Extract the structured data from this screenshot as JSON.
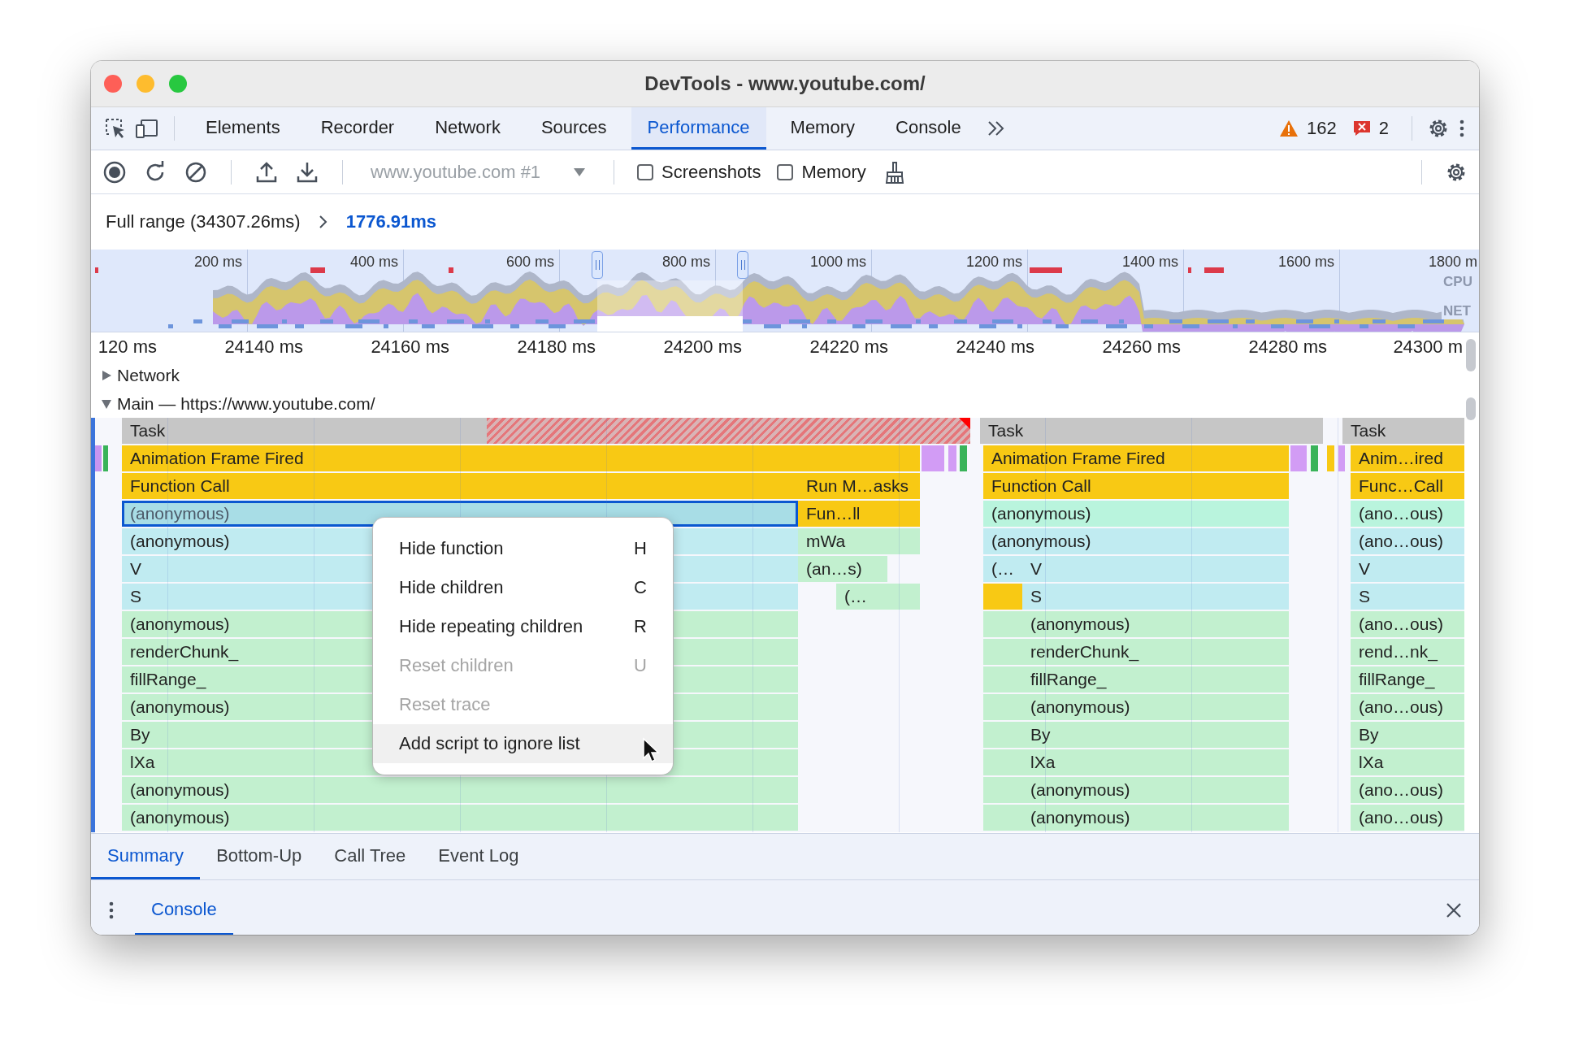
{
  "window": {
    "title": "DevTools - www.youtube.com/"
  },
  "tabs": [
    {
      "label": "Elements",
      "selected": false
    },
    {
      "label": "Recorder",
      "selected": false
    },
    {
      "label": "Network",
      "selected": false
    },
    {
      "label": "Sources",
      "selected": false
    },
    {
      "label": "Performance",
      "selected": true
    },
    {
      "label": "Memory",
      "selected": false
    },
    {
      "label": "Console",
      "selected": false
    }
  ],
  "issues": {
    "warnings": "162",
    "errors": "2"
  },
  "toolbar": {
    "target": "www.youtube.com #1",
    "checkboxes": [
      {
        "label": "Screenshots",
        "checked": false
      },
      {
        "label": "Memory",
        "checked": false
      }
    ]
  },
  "breadcrumb": {
    "full_range": "Full range (34307.26ms)",
    "current": "1776.91ms"
  },
  "overview": {
    "ticks": [
      "200 ms",
      "400 ms",
      "600 ms",
      "800 ms",
      "1000 ms",
      "1200 ms",
      "1400 ms",
      "1600 ms",
      "1800 m"
    ],
    "cpu_label": "CPU",
    "net_label": "NET"
  },
  "ruler": [
    "120 ms",
    "24140 ms",
    "24160 ms",
    "24180 ms",
    "24200 ms",
    "24220 ms",
    "24240 ms",
    "24260 ms",
    "24280 ms",
    "24300 m"
  ],
  "tracks": [
    {
      "label": "Network",
      "expanded": false
    },
    {
      "label": "Main — https://www.youtube.com/",
      "expanded": true
    }
  ],
  "flame_chart": {
    "columns": [
      {
        "rows": [
          {
            "label": "Task",
            "kind": "task",
            "selected": false,
            "long": true
          },
          {
            "label": "Animation Frame Fired",
            "kind": "event",
            "selected": false
          },
          {
            "label": "Function Call",
            "kind": "event",
            "selected": false
          },
          {
            "label": "(anonymous)",
            "kind": "script-teal",
            "selected": true
          },
          {
            "label": "(anonymous)",
            "kind": "script-cyan",
            "selected": false
          },
          {
            "label": "V",
            "kind": "script-cyan",
            "selected": false
          },
          {
            "label": "S",
            "kind": "script-cyan",
            "selected": false
          },
          {
            "label": "(anonymous)",
            "kind": "script-green",
            "selected": false
          },
          {
            "label": "renderChunk_",
            "kind": "script-green",
            "selected": false
          },
          {
            "label": "fillRange_",
            "kind": "script-green",
            "selected": false
          },
          {
            "label": "(anonymous)",
            "kind": "script-green",
            "selected": false
          },
          {
            "label": "By",
            "kind": "script-green",
            "selected": false
          },
          {
            "label": "lXa",
            "kind": "script-green",
            "selected": false
          },
          {
            "label": "(anonymous)",
            "kind": "script-green",
            "selected": false
          },
          {
            "label": "(anonymous)",
            "kind": "script-green",
            "selected": false
          }
        ]
      },
      {
        "rows": [
          {
            "label": "Run M…asks",
            "kind": "event",
            "selected": false
          },
          {
            "label": "Fun…ll",
            "kind": "event",
            "selected": false
          },
          {
            "label": "mWa",
            "kind": "script-green",
            "selected": false
          },
          {
            "label": "(an…s)",
            "kind": "script-green",
            "selected": false
          },
          {
            "label": "(…",
            "kind": "script-green",
            "selected": false
          }
        ]
      },
      {
        "rows": [
          {
            "label": "Task",
            "kind": "task",
            "selected": false,
            "long": false
          },
          {
            "label": "Animation Frame Fired",
            "kind": "event",
            "selected": false
          },
          {
            "label": "Function Call",
            "kind": "event",
            "selected": false
          },
          {
            "label": "(anonymous)",
            "kind": "script-mint",
            "selected": false
          },
          {
            "label": "(anonymous)",
            "kind": "script-cyan",
            "selected": false
          },
          {
            "label": "V",
            "kind": "script-cyan",
            "selected": false,
            "lead": {
              "label": "(…",
              "kind": "script-cyan"
            }
          },
          {
            "label": "S",
            "kind": "script-cyan",
            "selected": false,
            "lead": {
              "kind": "event"
            }
          },
          {
            "label": "(anonymous)",
            "kind": "script-green",
            "selected": false,
            "lead": {
              "kind": "script-green"
            }
          },
          {
            "label": "renderChunk_",
            "kind": "script-green",
            "selected": false,
            "lead": {
              "kind": "script-green"
            }
          },
          {
            "label": "fillRange_",
            "kind": "script-green",
            "selected": false,
            "lead": {
              "kind": "script-green"
            }
          },
          {
            "label": "(anonymous)",
            "kind": "script-green",
            "selected": false,
            "lead": {
              "kind": "script-green"
            }
          },
          {
            "label": "By",
            "kind": "script-green",
            "selected": false,
            "lead": {
              "kind": "script-green"
            }
          },
          {
            "label": "lXa",
            "kind": "script-green",
            "selected": false,
            "lead": {
              "kind": "script-green"
            }
          },
          {
            "label": "(anonymous)",
            "kind": "script-green",
            "selected": false,
            "lead": {
              "kind": "script-green"
            }
          },
          {
            "label": "(anonymous)",
            "kind": "script-green",
            "selected": false,
            "lead": {
              "kind": "script-green"
            }
          }
        ]
      },
      {
        "rows": [
          {
            "label": "Task",
            "kind": "task",
            "selected": false,
            "long": false
          },
          {
            "label": "Anim…ired",
            "kind": "event",
            "selected": false
          },
          {
            "label": "Func…Call",
            "kind": "event",
            "selected": false
          },
          {
            "label": "(ano…ous)",
            "kind": "script-mint",
            "selected": false
          },
          {
            "label": "(ano…ous)",
            "kind": "script-cyan",
            "selected": false
          },
          {
            "label": "V",
            "kind": "script-cyan",
            "selected": false
          },
          {
            "label": "S",
            "kind": "script-cyan",
            "selected": false
          },
          {
            "label": "(ano…ous)",
            "kind": "script-green",
            "selected": false
          },
          {
            "label": "rend…nk_",
            "kind": "script-green",
            "selected": false
          },
          {
            "label": "fillRange_",
            "kind": "script-green",
            "selected": false
          },
          {
            "label": "(ano…ous)",
            "kind": "script-green",
            "selected": false
          },
          {
            "label": "By",
            "kind": "script-green",
            "selected": false
          },
          {
            "label": "lXa",
            "kind": "script-green",
            "selected": false
          },
          {
            "label": "(ano…ous)",
            "kind": "script-green",
            "selected": false
          },
          {
            "label": "(ano…ous)",
            "kind": "script-green",
            "selected": false
          }
        ]
      }
    ]
  },
  "context_menu": {
    "items": [
      {
        "label": "Hide function",
        "shortcut": "H",
        "disabled": false,
        "highlighted": false
      },
      {
        "label": "Hide children",
        "shortcut": "C",
        "disabled": false,
        "highlighted": false
      },
      {
        "label": "Hide repeating children",
        "shortcut": "R",
        "disabled": false,
        "highlighted": false
      },
      {
        "label": "Reset children",
        "shortcut": "U",
        "disabled": true,
        "highlighted": false
      },
      {
        "label": "Reset trace",
        "disabled": true,
        "highlighted": false
      },
      {
        "label": "Add script to ignore list",
        "disabled": false,
        "highlighted": true
      }
    ]
  },
  "bottom_tabs": [
    {
      "label": "Summary",
      "selected": true
    },
    {
      "label": "Bottom-Up",
      "selected": false
    },
    {
      "label": "Call Tree",
      "selected": false
    },
    {
      "label": "Event Log",
      "selected": false
    }
  ],
  "drawer": {
    "tabs": [
      {
        "label": "Console",
        "selected": true
      }
    ]
  }
}
